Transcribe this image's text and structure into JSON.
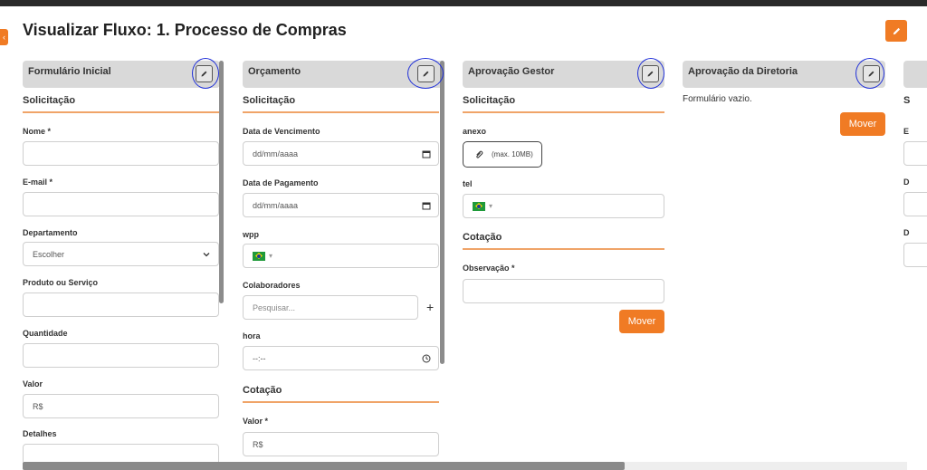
{
  "page": {
    "title": "Visualizar Fluxo: 1. Processo de Compras"
  },
  "colors": {
    "accent": "#f07b24",
    "header_bg": "#d9d9d9",
    "annotation": "#2030d8"
  },
  "icons": {
    "edit": "pencil-icon",
    "back": "chevron-left-icon",
    "date": "calendar-icon",
    "time": "clock-icon",
    "attach": "paperclip-icon",
    "select": "chevron-down-icon",
    "add": "plus-icon",
    "flag": "brazil-flag-icon"
  },
  "columns": [
    {
      "title": "Formulário Inicial",
      "section": "Solicitação",
      "fields": [
        {
          "label": "Nome *",
          "value": ""
        },
        {
          "label": "E-mail *",
          "value": ""
        },
        {
          "label": "Departamento",
          "value": "Escolher"
        },
        {
          "label": "Produto ou Serviço",
          "value": ""
        },
        {
          "label": "Quantidade",
          "value": ""
        },
        {
          "label": "Valor",
          "value": "R$"
        },
        {
          "label": "Detalhes",
          "value": ""
        }
      ]
    },
    {
      "title": "Orçamento",
      "section": "Solicitação",
      "fields": [
        {
          "label": "Data de Vencimento",
          "value": "dd/mm/aaaa"
        },
        {
          "label": "Data de Pagamento",
          "value": "dd/mm/aaaa"
        },
        {
          "label": "wpp",
          "value": ""
        },
        {
          "label": "Colaboradores",
          "placeholder": "Pesquisar..."
        },
        {
          "label": "hora",
          "value": "--:--"
        }
      ],
      "section2": "Cotação",
      "fields2": [
        {
          "label": "Valor *",
          "value": "R$"
        }
      ]
    },
    {
      "title": "Aprovação Gestor",
      "section": "Solicitação",
      "fields": [
        {
          "label": "anexo",
          "value": "(max. 10MB)"
        },
        {
          "label": "tel",
          "value": ""
        }
      ],
      "section2": "Cotação",
      "fields2": [
        {
          "label": "Observação *",
          "value": ""
        }
      ],
      "button": "Mover"
    },
    {
      "title": "Aprovação da Diretoria",
      "empty_text": "Formulário vazio.",
      "button": "Mover"
    },
    {
      "title": "",
      "section": "S",
      "fields": [
        {
          "label": "E"
        },
        {
          "label": "D"
        },
        {
          "label": "D"
        }
      ]
    }
  ]
}
